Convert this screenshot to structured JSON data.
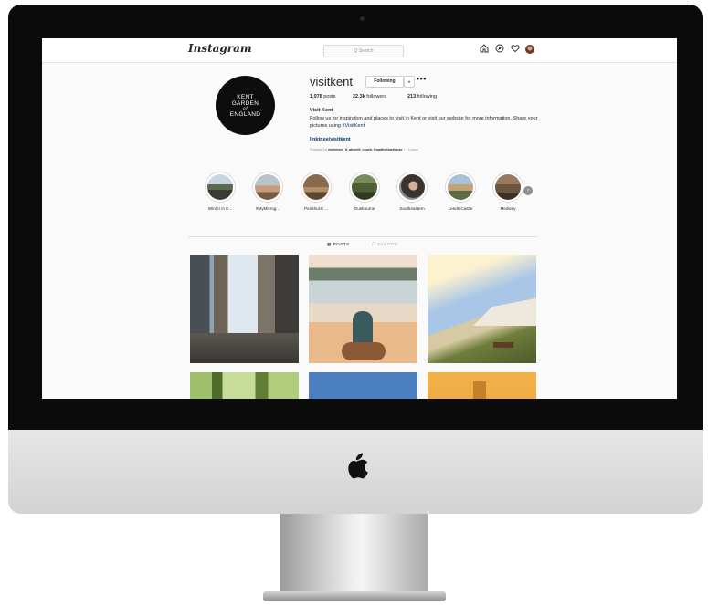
{
  "topbar": {
    "logo": "Instagram",
    "search_placeholder": "Q Search",
    "icons": [
      "home-icon",
      "explore-icon",
      "heart-icon",
      "profile-avatar"
    ]
  },
  "profile": {
    "avatar_lines": [
      "KENT",
      "GARDEN",
      "of",
      "ENGLAND"
    ],
    "username": "visitkent",
    "following_label": "Following",
    "dropdown_glyph": "▾",
    "more_glyph": "•••",
    "posts_count": "1,078",
    "posts_label": "posts",
    "followers_count": "22.3k",
    "followers_label": "followers",
    "following_count": "213",
    "following_label2": "following",
    "bio_name": "Visit Kent",
    "bio_text_1": "Follow us for inspiration and places to visit in Kent or visit our website for more information. Share your pictures using",
    "bio_hashtag": "#VisitKent",
    "bio_link": "linktr.ee/visitkent",
    "followed_by_prefix": "Followed by",
    "followed_by_names": "mclement_8, alexrelt_couch, fromthebluehouse",
    "followed_by_more": "+ 14 more"
  },
  "highlights": [
    {
      "label": "Winter in K..."
    },
    {
      "label": "#MyMicrog..."
    },
    {
      "label": "Penshurst ..."
    },
    {
      "label": "Gusbourne"
    },
    {
      "label": "Southeastern"
    },
    {
      "label": "Leeds Castle"
    },
    {
      "label": "Medway"
    }
  ],
  "tabs": {
    "posts": "▦ POSTS",
    "tagged": "☐ TAGGED"
  },
  "colors": {
    "link": "#00376b",
    "text": "#262626",
    "muted": "#8e8e8e"
  }
}
